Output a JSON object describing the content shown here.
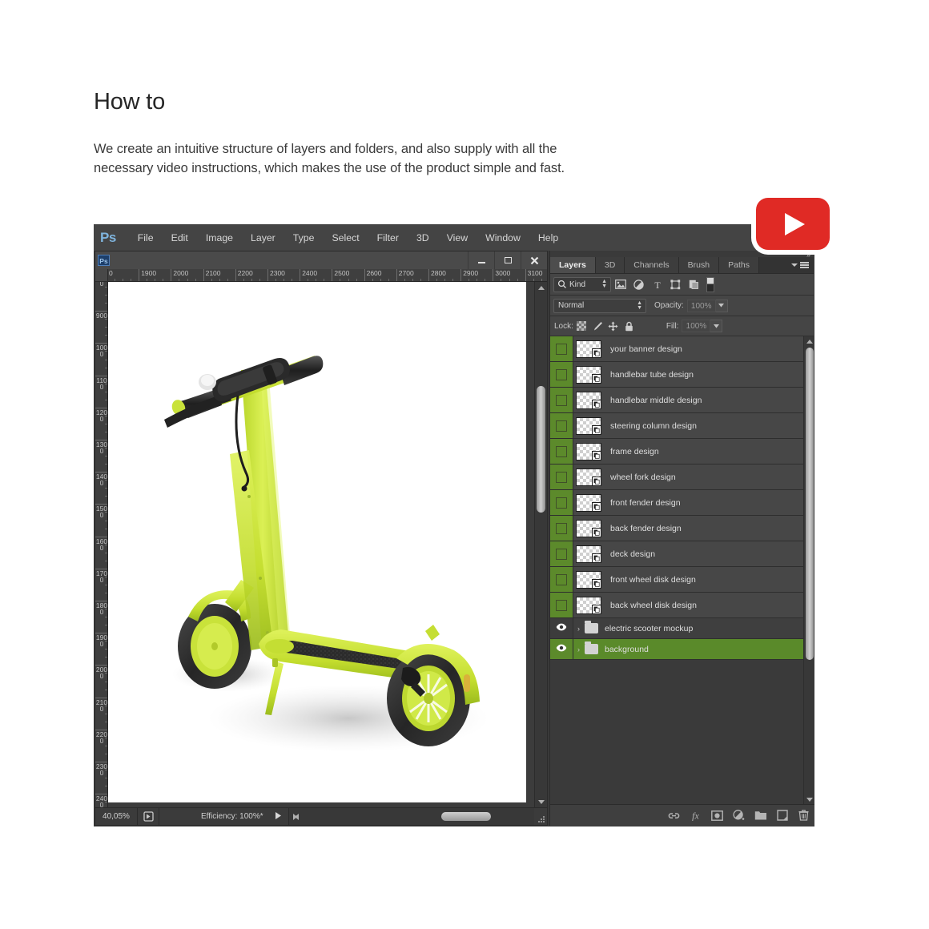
{
  "intro": {
    "title": "How to",
    "body": "We create an intuitive structure of layers and folders, and also supply with all the necessary video instructions, which makes the use of the product simple and fast."
  },
  "badge": {
    "name": "youtube-play-badge",
    "color": "#e02a25"
  },
  "photoshop": {
    "logo": "Ps",
    "menu": [
      "File",
      "Edit",
      "Image",
      "Layer",
      "Type",
      "Select",
      "Filter",
      "3D",
      "View",
      "Window",
      "Help"
    ],
    "document": {
      "title": "",
      "icon": "Ps",
      "window_buttons": [
        "minimize",
        "maximize",
        "close"
      ],
      "ruler_horizontal": [
        "0",
        "1900",
        "2000",
        "2100",
        "2200",
        "2300",
        "2400",
        "2500",
        "2600",
        "2700",
        "2800",
        "2900",
        "3000",
        "3100"
      ],
      "ruler_vertical": [
        "0",
        "900",
        "1000",
        "1100",
        "1200",
        "1300",
        "1400",
        "1500",
        "1600",
        "1700",
        "1800",
        "1900",
        "2000",
        "2100",
        "2200",
        "2300",
        "2400"
      ],
      "status": {
        "zoom": "40,05%",
        "efficiency": "Efficiency: 100%*"
      }
    },
    "panel": {
      "tabs": [
        {
          "label": "Layers",
          "active": true
        },
        {
          "label": "3D",
          "active": false
        },
        {
          "label": "Channels",
          "active": false
        },
        {
          "label": "Brush",
          "active": false
        },
        {
          "label": "Paths",
          "active": false
        }
      ],
      "filter": {
        "kind_label": "Kind",
        "search_icon": "search-icon",
        "icons": [
          "pixel-layer-filter-icon",
          "adjustment-layer-filter-icon",
          "type-layer-filter-icon",
          "shape-layer-filter-icon",
          "smart-object-filter-icon"
        ],
        "toggle": "filter-enable-toggle"
      },
      "blend": {
        "mode": "Normal",
        "opacity_label": "Opacity:",
        "opacity_value": "100%"
      },
      "lock": {
        "label": "Lock:",
        "icons": [
          "lock-transparent-pixels-icon",
          "lock-image-pixels-icon",
          "lock-position-icon",
          "lock-all-icon"
        ],
        "fill_label": "Fill:",
        "fill_value": "100%"
      },
      "layers": [
        {
          "name": "your banner design",
          "type": "smart-object",
          "visible": false,
          "selected": false
        },
        {
          "name": "handlebar tube design",
          "type": "smart-object",
          "visible": false,
          "selected": false
        },
        {
          "name": "handlebar middle design",
          "type": "smart-object",
          "visible": false,
          "selected": false
        },
        {
          "name": "steering column design",
          "type": "smart-object",
          "visible": false,
          "selected": false
        },
        {
          "name": "frame design",
          "type": "smart-object",
          "visible": false,
          "selected": false
        },
        {
          "name": "wheel fork design",
          "type": "smart-object",
          "visible": false,
          "selected": false
        },
        {
          "name": "front fender design",
          "type": "smart-object",
          "visible": false,
          "selected": false
        },
        {
          "name": "back fender design",
          "type": "smart-object",
          "visible": false,
          "selected": false
        },
        {
          "name": "deck design",
          "type": "smart-object",
          "visible": false,
          "selected": false
        },
        {
          "name": "front wheel disk design",
          "type": "smart-object",
          "visible": false,
          "selected": false
        },
        {
          "name": "back wheel disk design",
          "type": "smart-object",
          "visible": false,
          "selected": false
        },
        {
          "name": "electric scooter mockup",
          "type": "group",
          "visible": true,
          "selected": false
        },
        {
          "name": "background",
          "type": "group",
          "visible": true,
          "selected": true
        }
      ],
      "bottom_icons": [
        "link-layers-icon",
        "add-layer-style-icon",
        "add-layer-mask-icon",
        "new-adjustment-layer-icon",
        "new-group-icon",
        "new-layer-icon",
        "delete-layer-icon"
      ]
    }
  },
  "artwork": {
    "subject": "electric scooter mockup",
    "body_color": "#d4e84a",
    "accent_color": "#c3dd2e",
    "tire_color": "#2e2e2e"
  }
}
